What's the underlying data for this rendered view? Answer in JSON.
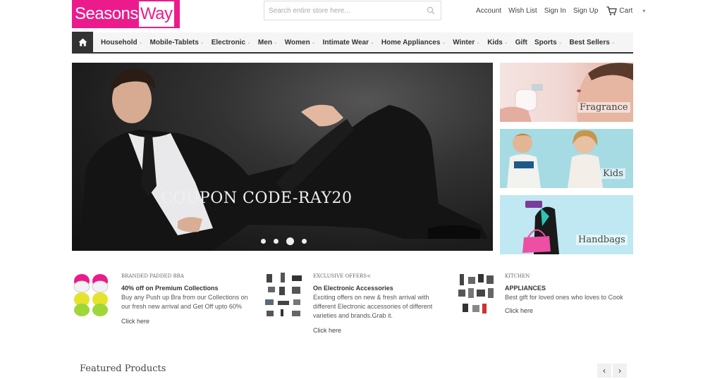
{
  "brand": {
    "part1": "Seasons",
    "part2": "Way",
    "color": "#ec1b8c"
  },
  "search": {
    "placeholder": "Search entire store here..."
  },
  "toplinks": {
    "account": "Account",
    "wishlist": "Wish List",
    "signin": "Sign In",
    "signup": "Sign Up",
    "cart": "Cart"
  },
  "nav": {
    "items": [
      {
        "label": "Household",
        "dropdown": true
      },
      {
        "label": "Mobile-Tablets",
        "dropdown": true
      },
      {
        "label": "Electronic",
        "dropdown": true
      },
      {
        "label": "Men",
        "dropdown": true
      },
      {
        "label": "Women",
        "dropdown": true
      },
      {
        "label": "Intimate Wear",
        "dropdown": true
      },
      {
        "label": "Home Appliances",
        "dropdown": true
      },
      {
        "label": "Winter",
        "dropdown": true
      },
      {
        "label": "Kids",
        "dropdown": true
      },
      {
        "label": "Gift",
        "dropdown": false
      },
      {
        "label": "Sports",
        "dropdown": true
      },
      {
        "label": "Best Sellers",
        "dropdown": true
      }
    ]
  },
  "hero": {
    "caption": "COUPON CODE-RAY20",
    "slides": 4,
    "active_slide": 3
  },
  "banners": {
    "fragrance": "Fragrance",
    "kids": "Kids",
    "handbags": "Handbags"
  },
  "promos": [
    {
      "kicker": "BRANDED PADDED BRA",
      "headline": "40% off on Premium Collections",
      "description": "Buy any Push up Bra from our Collections on our fresh new arrival and Get Off upto 60%",
      "link": "Click here"
    },
    {
      "kicker": "EXCLUSIVE OFFERS<",
      "headline": "On Electronic Accessories",
      "description": "Exciting offers on new & fresh arrival with different Electronic accessories of different varieties and brands.Grab it.",
      "link": "Click here"
    },
    {
      "kicker": "KITCHEN",
      "headline": "APPLIANCES",
      "description": "Best gift for loved ones who loves to Cook",
      "link": "Click here"
    }
  ],
  "featured": {
    "title": "Featured Products"
  },
  "icons": [
    "home-icon",
    "search-icon",
    "cart-icon",
    "chevron-left-icon",
    "chevron-right-icon"
  ]
}
